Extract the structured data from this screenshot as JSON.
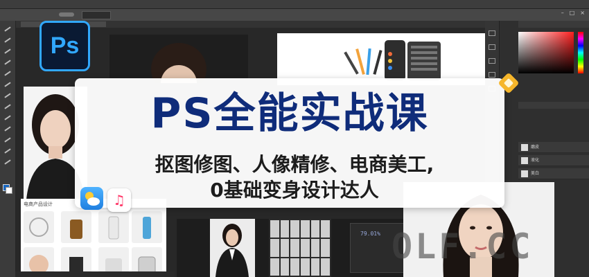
{
  "banner": {
    "title": "PS全能实战课",
    "subtitle_line1": "抠图修图、人像精修、电商美工,",
    "subtitle_line2": "0基础变身设计达人"
  },
  "logo": {
    "text": "Ps",
    "icon": "photoshop-logo-icon"
  },
  "ecommerce_card": {
    "title": "电商产品设计"
  },
  "layers": {
    "items": [
      {
        "label": "磨皮"
      },
      {
        "label": "液化"
      },
      {
        "label": "美白"
      }
    ]
  },
  "mini_panel": {
    "percent": "79.01%"
  },
  "watermark": {
    "text": "OLF.CC"
  },
  "colors": {
    "title_blue": "#0f2c7a",
    "ps_blue": "#31a8ff",
    "ps_dark": "#0a1a33",
    "ps_chrome": "#3a3a3a"
  },
  "icons": [
    "weather-app-icon",
    "music-app-icon",
    "diamond-badge-icon",
    "minimize-icon",
    "maximize-icon",
    "close-icon"
  ]
}
